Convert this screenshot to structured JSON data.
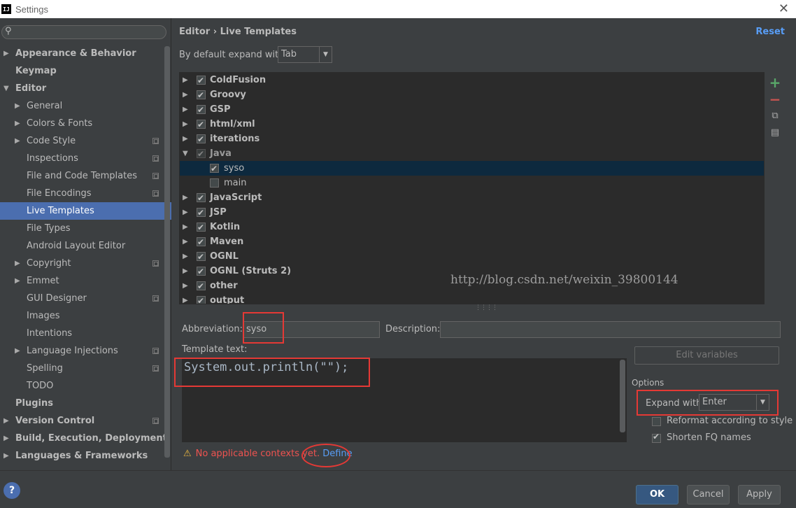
{
  "window": {
    "title": "Settings",
    "app_icon": "IJ"
  },
  "sidebar": {
    "search_placeholder": "",
    "items": [
      {
        "label": "Appearance & Behavior",
        "level": 0,
        "arrow": "right",
        "bold": true
      },
      {
        "label": "Keymap",
        "level": 0,
        "arrow": "",
        "bold": true
      },
      {
        "label": "Editor",
        "level": 0,
        "arrow": "down",
        "bold": true
      },
      {
        "label": "General",
        "level": 1,
        "arrow": "right"
      },
      {
        "label": "Colors & Fonts",
        "level": 1,
        "arrow": "right"
      },
      {
        "label": "Code Style",
        "level": 1,
        "arrow": "right",
        "copy": true
      },
      {
        "label": "Inspections",
        "level": 1,
        "arrow": "",
        "copy": true
      },
      {
        "label": "File and Code Templates",
        "level": 1,
        "arrow": "",
        "copy": true
      },
      {
        "label": "File Encodings",
        "level": 1,
        "arrow": "",
        "copy": true
      },
      {
        "label": "Live Templates",
        "level": 1,
        "arrow": "",
        "selected": true
      },
      {
        "label": "File Types",
        "level": 1,
        "arrow": ""
      },
      {
        "label": "Android Layout Editor",
        "level": 1,
        "arrow": ""
      },
      {
        "label": "Copyright",
        "level": 1,
        "arrow": "right",
        "copy": true
      },
      {
        "label": "Emmet",
        "level": 1,
        "arrow": "right"
      },
      {
        "label": "GUI Designer",
        "level": 1,
        "arrow": "",
        "copy": true
      },
      {
        "label": "Images",
        "level": 1,
        "arrow": ""
      },
      {
        "label": "Intentions",
        "level": 1,
        "arrow": ""
      },
      {
        "label": "Language Injections",
        "level": 1,
        "arrow": "right",
        "copy": true
      },
      {
        "label": "Spelling",
        "level": 1,
        "arrow": "",
        "copy": true
      },
      {
        "label": "TODO",
        "level": 1,
        "arrow": ""
      },
      {
        "label": "Plugins",
        "level": 0,
        "arrow": "",
        "bold": true
      },
      {
        "label": "Version Control",
        "level": 0,
        "arrow": "right",
        "bold": true,
        "copy": true
      },
      {
        "label": "Build, Execution, Deployment",
        "level": 0,
        "arrow": "right",
        "bold": true
      },
      {
        "label": "Languages & Frameworks",
        "level": 0,
        "arrow": "right",
        "bold": true
      }
    ]
  },
  "main": {
    "breadcrumb": "Editor › Live Templates",
    "reset": "Reset",
    "expand_default_label": "By default expand with",
    "expand_default_value": "Tab",
    "templates": [
      {
        "label": "ColdFusion",
        "type": "group",
        "checked": true,
        "arrow": "right"
      },
      {
        "label": "Groovy",
        "type": "group",
        "checked": true,
        "arrow": "right"
      },
      {
        "label": "GSP",
        "type": "group",
        "checked": true,
        "arrow": "right"
      },
      {
        "label": "html/xml",
        "type": "group",
        "checked": true,
        "arrow": "right"
      },
      {
        "label": "iterations",
        "type": "group",
        "checked": true,
        "arrow": "right"
      },
      {
        "label": "Java",
        "type": "group",
        "checked": true,
        "arrow": "down",
        "dim": true
      },
      {
        "label": "syso",
        "type": "item",
        "checked": true,
        "selected": true
      },
      {
        "label": "main",
        "type": "item",
        "checked": false
      },
      {
        "label": "JavaScript",
        "type": "group",
        "checked": true,
        "arrow": "right"
      },
      {
        "label": "JSP",
        "type": "group",
        "checked": true,
        "arrow": "right"
      },
      {
        "label": "Kotlin",
        "type": "group",
        "checked": true,
        "arrow": "right"
      },
      {
        "label": "Maven",
        "type": "group",
        "checked": true,
        "arrow": "right"
      },
      {
        "label": "OGNL",
        "type": "group",
        "checked": true,
        "arrow": "right"
      },
      {
        "label": "OGNL (Struts 2)",
        "type": "group",
        "checked": true,
        "arrow": "right"
      },
      {
        "label": "other",
        "type": "group",
        "checked": true,
        "arrow": "right"
      },
      {
        "label": "output",
        "type": "group",
        "checked": true,
        "arrow": "right"
      }
    ],
    "tools": {
      "add": "+",
      "remove": "−",
      "copy": "⧉",
      "note": "▤"
    },
    "abbreviation_label": "Abbreviation:",
    "abbreviation_value": "syso",
    "description_label": "Description:",
    "description_value": "",
    "template_text_label": "Template text:",
    "template_text": "System.out.println(\"\");",
    "edit_variables": "Edit variables",
    "options_label": "Options",
    "expand_with_label": "Expand with",
    "expand_with_value": "Enter",
    "reformat_label": "Reformat according to style",
    "reformat_checked": false,
    "shorten_label": "Shorten FQ names",
    "shorten_checked": true,
    "warning_text": "No applicable contexts yet.",
    "define_link": "Define",
    "watermark": "http://blog.csdn.net/weixin_39800144"
  },
  "footer": {
    "help": "?",
    "ok": "OK",
    "cancel": "Cancel",
    "apply": "Apply"
  },
  "colors": {
    "accent_selection": "#4b6eaf",
    "link": "#589df6",
    "annotation_red": "#e53935",
    "warning_red": "#ef5350"
  }
}
